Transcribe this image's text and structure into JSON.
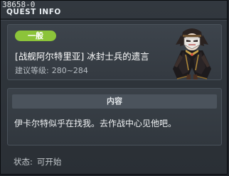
{
  "window": {
    "quest_id": "38658-0",
    "title": "QUEST INFO"
  },
  "summary": {
    "category": "一般",
    "quest_name": "[战舰阿尔特里亚] 冰封士兵的遗言",
    "recommended_level_label": "建议等级:",
    "recommended_level": "280~284"
  },
  "detail": {
    "header": "内容",
    "text": "伊卡尔特似乎在找我。去作战中心见他吧。"
  },
  "status": {
    "label": "状态:",
    "value": "可开始"
  },
  "colors": {
    "category_badge": "#8cc43a",
    "panel": "#3a4148",
    "window_bg": "#2a2f35"
  },
  "icons": {
    "npc": "masked-npc-portrait"
  }
}
